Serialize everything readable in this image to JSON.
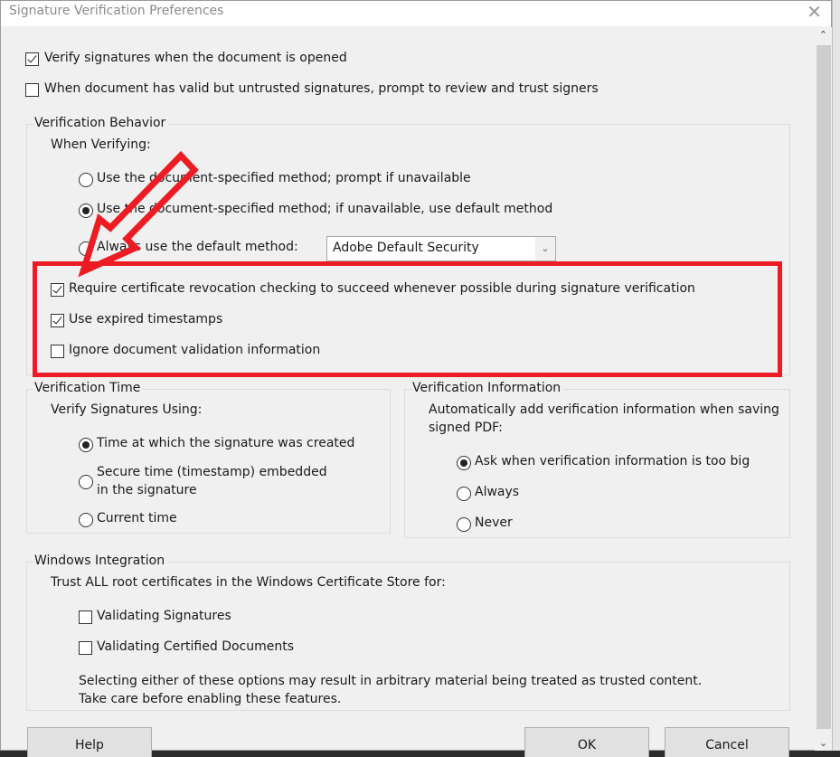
{
  "window": {
    "title": "Signature Verification Preferences",
    "close_icon": "close-icon"
  },
  "top_options": [
    {
      "label": "Verify signatures when the document is opened",
      "checked": true
    },
    {
      "label": "When document has valid but untrusted signatures, prompt to review and trust signers",
      "checked": false
    }
  ],
  "verification_behavior": {
    "legend": "Verification Behavior",
    "subheading": "When Verifying:",
    "methods": [
      {
        "label": "Use the document-specified method; prompt if unavailable",
        "selected": false
      },
      {
        "label": "Use the document-specified method; if unavailable, use default method",
        "selected": true
      },
      {
        "label": "Always use the default method:",
        "selected": false
      }
    ],
    "default_method_select": {
      "value": "Adobe Default Security"
    },
    "options": [
      {
        "label": "Require certificate revocation checking to succeed whenever possible during signature verification",
        "checked": true
      },
      {
        "label": "Use expired timestamps",
        "checked": true
      },
      {
        "label": "Ignore document validation information",
        "checked": false
      }
    ]
  },
  "verification_time": {
    "legend": "Verification Time",
    "subheading": "Verify Signatures Using:",
    "options": [
      {
        "label": "Time at which the signature was created",
        "selected": true
      },
      {
        "label_line1": "Secure time (timestamp) embedded",
        "label_line2": "in the signature",
        "selected": false
      },
      {
        "label": "Current time",
        "selected": false
      }
    ]
  },
  "verification_information": {
    "legend": "Verification Information",
    "subheading_line1": "Automatically add verification information when saving",
    "subheading_line2": "signed PDF:",
    "options": [
      {
        "label": "Ask when verification information is too big",
        "selected": true
      },
      {
        "label": "Always",
        "selected": false
      },
      {
        "label": "Never",
        "selected": false
      }
    ]
  },
  "windows_integration": {
    "legend": "Windows Integration",
    "subheading": "Trust ALL root certificates in the Windows Certificate Store for:",
    "options": [
      {
        "label": "Validating Signatures",
        "checked": false
      },
      {
        "label": "Validating Certified Documents",
        "checked": false
      }
    ],
    "warning_line1": "Selecting either of these options may result in arbitrary material being treated as trusted content.",
    "warning_line2": "Take care before enabling these features."
  },
  "buttons": {
    "help": "Help",
    "ok": "OK",
    "cancel": "Cancel"
  },
  "annotation": {
    "highlight_color": "#ed1c24"
  }
}
